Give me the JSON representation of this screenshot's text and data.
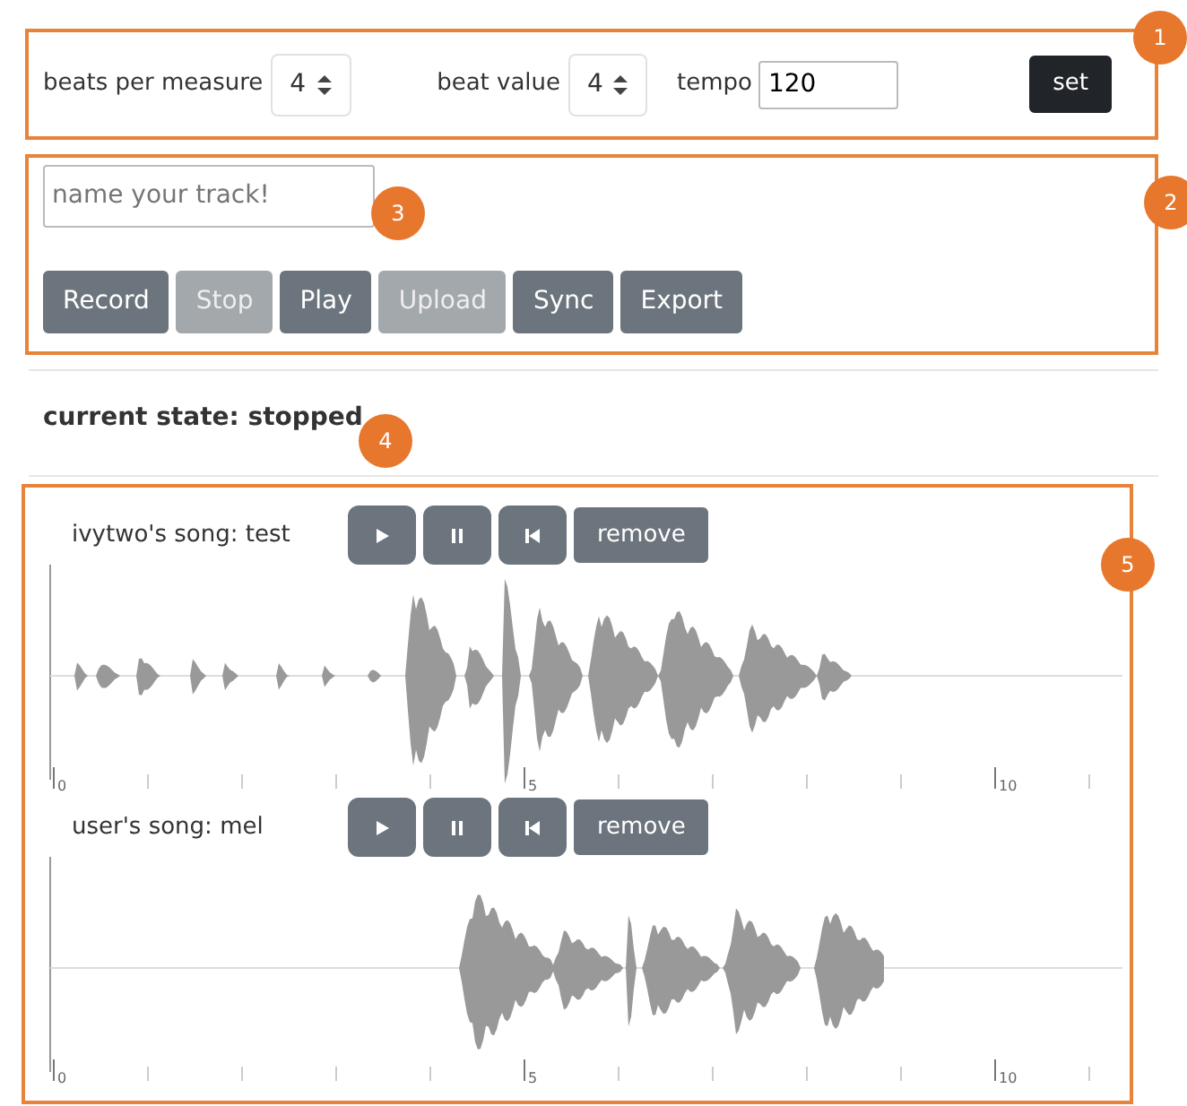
{
  "time_signature": {
    "callout": "1",
    "beats_per_measure_label": "beats per measure",
    "beats_per_measure": "4",
    "beat_value_label": "beat value",
    "beat_value": "4",
    "tempo_label": "tempo",
    "tempo": "120",
    "set_button": "set"
  },
  "recorder": {
    "callout": "2",
    "track_name_placeholder": "name your track!",
    "track_name_callout": "3",
    "buttons": [
      {
        "label": "Record",
        "disabled": false
      },
      {
        "label": "Stop",
        "disabled": true
      },
      {
        "label": "Play",
        "disabled": false
      },
      {
        "label": "Upload",
        "disabled": true
      },
      {
        "label": "Sync",
        "disabled": false
      },
      {
        "label": "Export",
        "disabled": false
      }
    ]
  },
  "status": {
    "text": "current state: stopped",
    "callout": "4"
  },
  "tracks": {
    "callout": "5",
    "items": [
      {
        "title": "ivytwo's song: test",
        "remove_button": "remove",
        "timeline_labels": [
          "0",
          "5",
          "10"
        ]
      },
      {
        "title": "user's song: mel",
        "remove_button": "remove",
        "timeline_labels": [
          "0",
          "5",
          "10"
        ]
      }
    ]
  }
}
